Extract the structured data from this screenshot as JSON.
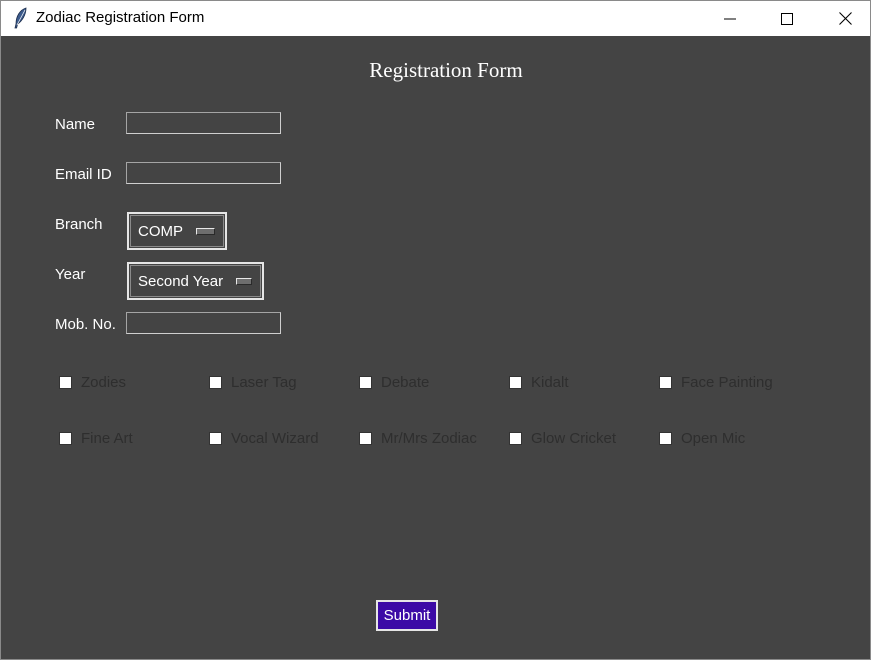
{
  "window": {
    "title": "Zodiac Registration Form"
  },
  "form": {
    "title": "Registration Form",
    "fields": {
      "name": {
        "label": "Name",
        "value": ""
      },
      "email": {
        "label": "Email ID",
        "value": ""
      },
      "branch": {
        "label": "Branch",
        "selected": "COMP"
      },
      "year": {
        "label": "Year",
        "selected": "Second Year"
      },
      "mobile": {
        "label": "Mob. No.",
        "value": ""
      }
    },
    "events": [
      {
        "label": "Zodies",
        "checked": false
      },
      {
        "label": "Laser Tag",
        "checked": false
      },
      {
        "label": "Debate",
        "checked": false
      },
      {
        "label": "Kidalt",
        "checked": false
      },
      {
        "label": "Face Painting",
        "checked": false
      },
      {
        "label": "Fine Art",
        "checked": false
      },
      {
        "label": "Vocal Wizard",
        "checked": false
      },
      {
        "label": "Mr/Mrs Zodiac",
        "checked": false
      },
      {
        "label": "Glow Cricket",
        "checked": false
      },
      {
        "label": "Open Mic",
        "checked": false
      }
    ],
    "submit_label": "Submit"
  },
  "icons": {
    "app": "feather-icon",
    "minimize": "minimize-icon",
    "maximize": "maximize-icon",
    "close": "close-icon"
  },
  "colors": {
    "background": "#444444",
    "submit_button": "#3c0aa6",
    "text": "#ffffff",
    "checkbox_label": "#2e2e2e"
  }
}
